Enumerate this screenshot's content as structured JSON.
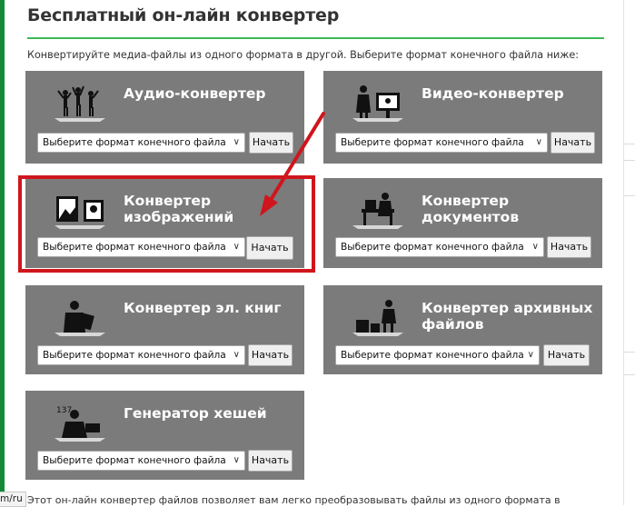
{
  "page": {
    "title": "Бесплатный он-лайн конвертер",
    "subtitle": "Конвертируйте медиа-файлы из одного формата в другой. Выберите формат конечного файла ниже:",
    "accent_color": "#3cba54",
    "highlight_color": "#d0151c",
    "card_color": "#7b7b7b"
  },
  "converters": [
    {
      "name": "Аудио-конвертер",
      "icon": "audio-people-icon",
      "select_placeholder": "Выберите формат конечного файла",
      "button": "Начать"
    },
    {
      "name": "Видео-конвертер",
      "icon": "video-screen-icon",
      "select_placeholder": "Выберите формат конечного файла",
      "button": "Начать"
    },
    {
      "name": "Конвертер изображений",
      "icon": "image-frames-icon",
      "select_placeholder": "Выберите формат конечного файла",
      "button": "Начать",
      "highlighted": true
    },
    {
      "name": "Конвертер документов",
      "icon": "document-desk-icon",
      "select_placeholder": "Выберите формат конечного файла",
      "button": "Начать"
    },
    {
      "name": "Конвертер эл. книг",
      "icon": "ebook-reader-icon",
      "select_placeholder": "Выберите формат конечного файла",
      "button": "Начать"
    },
    {
      "name": "Конвертер архивных файлов",
      "icon": "archive-boxes-icon",
      "select_placeholder": "Выберите формат конечного файла",
      "button": "Начать"
    },
    {
      "name": "Генератор хешей",
      "icon": "hash-person-icon",
      "select_placeholder": "Выберите формат конечного файла",
      "button": "Начать"
    }
  ],
  "footer": {
    "status_url": "m/ru",
    "text": "Этот он-лайн конвертер файлов позволяет вам легко преобразовывать файлы из одного формата в"
  }
}
